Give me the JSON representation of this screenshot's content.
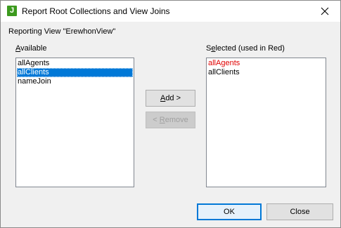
{
  "window": {
    "icon_letter": "J",
    "title": "Report Root Collections and View Joins",
    "close_glyph": "✕"
  },
  "reporting_view": "Reporting View \"ErewhonView\"",
  "available": {
    "label_pre": "",
    "label_mnemonic": "A",
    "label_post": "vailable",
    "items": [
      "allAgents",
      "allClients",
      "nameJoin"
    ],
    "selected_item": "allClients"
  },
  "selected": {
    "label_pre": "S",
    "label_mnemonic": "e",
    "label_post": "lected (used in Red)",
    "items": [
      "allAgents",
      "allClients"
    ],
    "red_item": "allAgents",
    "red_color": "#e00000"
  },
  "buttons": {
    "add_mnemonic": "A",
    "add_rest": "dd >",
    "remove_pre": "< ",
    "remove_mnemonic": "R",
    "remove_rest": "emove",
    "ok": "OK",
    "close": "Close"
  },
  "colors": {
    "selection": "#0078d7",
    "dialog_bg": "#f0f0f0"
  }
}
